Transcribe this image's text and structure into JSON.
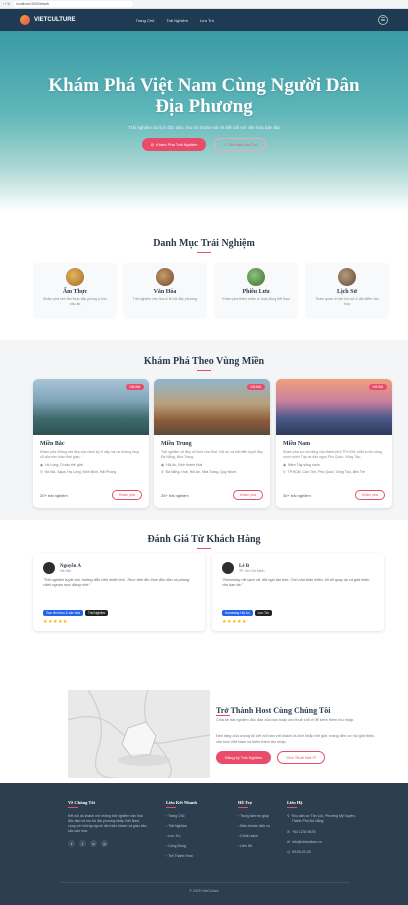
{
  "browser": {
    "url": "localhost:3000/#/web",
    "tabs": "‹ › ↻"
  },
  "nav": {
    "brand": "VIETCULTURE",
    "links": [
      "Trang Chủ",
      "Trải Nghiệm",
      "Lưu Trú"
    ],
    "menu_icon": "☰"
  },
  "hero": {
    "title": "Khám Phá Việt Nam Cùng Người Dân Địa Phương",
    "subtitle": "Trải nghiệm du lịch độc đáo, lưu trú thoải mái và kết nối với văn hóa bản địa",
    "btn_primary": "Khám Phá Trải Nghiệm",
    "btn_secondary": "Tìm Nơi Lưu Trú"
  },
  "categories": {
    "title": "Danh Mục Trải Nghiệm",
    "items": [
      {
        "title": "Ẩm Thực",
        "desc": "Khám phá nền ẩm thực đặc phong & học nấu ăn"
      },
      {
        "title": "Văn Hóa",
        "desc": "Trải nghiệm văn hóa & lễ hội đặc phương"
      },
      {
        "title": "Phiêu Lưu",
        "desc": "Khám phá thiên nhiên & hoạt động thể thao"
      },
      {
        "title": "Lịch Sử",
        "desc": "Tham quan di tích lịch sử & địa điểm văn hóa"
      }
    ]
  },
  "regions": {
    "title": "Khám Phá Theo Vùng Miền",
    "badge": "Nổi Bật",
    "items": [
      {
        "title": "Miền Bắc",
        "desc": "Khám phá những nét đẹp của cảnh kỳ vĩ dãy núi và những làng cổ của nền thần thời gian.",
        "spots": "Hồ Long, Di sản thế giới",
        "places": "Hà Nội, Sapa, Hạ Long, Ninh Bình, Hải Phòng",
        "count": "20+ trải nghiệm",
        "btn": "Khám phá"
      },
      {
        "title": "Miền Trung",
        "desc": "Trải nghiệm vẻ đẹp cổ kính của Huế, Hội An và bãi biển tuyệt đẹp Đà Nẵng, Nha Trang.",
        "spots": "Hội An, Kinh thành Huế",
        "places": "Đà Nẵng, Huế, Hội An, Nha Trang, Quy Nhơn",
        "count": "25+ trải nghiệm",
        "btn": "Khám phá"
      },
      {
        "title": "Miền Nam",
        "desc": "Khám phá sự sôi động của thành phố TP.HCM, miệt vườn sông nước miền Tây và đảo ngọc Phú Quốc, Vũng Tàu.",
        "spots": "Miền Tây sông nước",
        "places": "TP.HCM, Cần Thơ, Phú Quốc, Vũng Tàu, Bến Tre",
        "count": "30+ trải nghiệm",
        "btn": "Khám phá"
      }
    ]
  },
  "reviews": {
    "title": "Đánh Giá Từ Khách Hàng",
    "items": [
      {
        "name": "Nguyễn A",
        "loc": "Hà Nội",
        "quote": "\"Trải nghiệm tuyệt vời, hướng dẫn viên nhiệt tình. Thực đơn ẩm thực độc đáo và phong cảnh ngoạn mục đáng nhớ.\"",
        "tag1": "Tour ẩm thực & văn hóa",
        "tag2": "Trải Nghiệm",
        "stars": "★★★★★"
      },
      {
        "name": "Lê B",
        "loc": "TP. Hồ Chí Minh",
        "quote": "\"Homestay rất sạch sẽ, đội ngũ tận tình. Chủ nhà thân thiện, tôi sẽ quay lại và giới thiệu cho bạn bè.\"",
        "tag1": "Homestay Hội An",
        "tag2": "Lưu Trú",
        "stars": "★★★★★"
      }
    ]
  },
  "host": {
    "title": "Trở Thành Host Cùng Chúng Tôi",
    "desc1": "Chia sẻ trải nghiệm độc đáo của bạn hoặc cho thuê chỗ ở để kiếm thêm thu nhập.",
    "desc2": "Nền tảng của chúng tôi kết nối bạn với khách du lịch khắp thế giới, mang đến cơ hội giới thiệu văn hóa Việt Nam và kiếm thêm thu nhập.",
    "btn1": "Đăng ký Trải Nghiệm",
    "btn2": "Cho Thuê Nơi Ở"
  },
  "footer": {
    "about_h": "Về Chúng Tôi",
    "about_text": "Kết nối du khách với những trải nghiệm văn hóa độc đáo và lưu trú địa phương khắp Việt Nam, cùng với những người dân hiếu khách và giàu bản sắc văn hóa.",
    "social": [
      "f",
      "t",
      "in",
      "yt"
    ],
    "links_h": "Liên Kết Nhanh",
    "links": [
      "Trang Chủ",
      "Trải Nghiệm",
      "Lưu Trú",
      "Cộng Đồng",
      "Trở Thành Host"
    ],
    "support_h": "Hỗ Trợ",
    "support": [
      "Trung tâm trợ giúp",
      "Điều khoản dịch vụ",
      "Chính sách",
      "Liên Hệ"
    ],
    "contact_h": "Liên Hệ",
    "contact": [
      "Khu dân cư Tân Lộc, Phường Mỹ Xuyên, Thành Phố Đà Nẵng",
      "+84 1234 5678",
      "info@vietculture.vn",
      "09:00-21:00"
    ],
    "copyright": "© 2025 VietCulture"
  }
}
